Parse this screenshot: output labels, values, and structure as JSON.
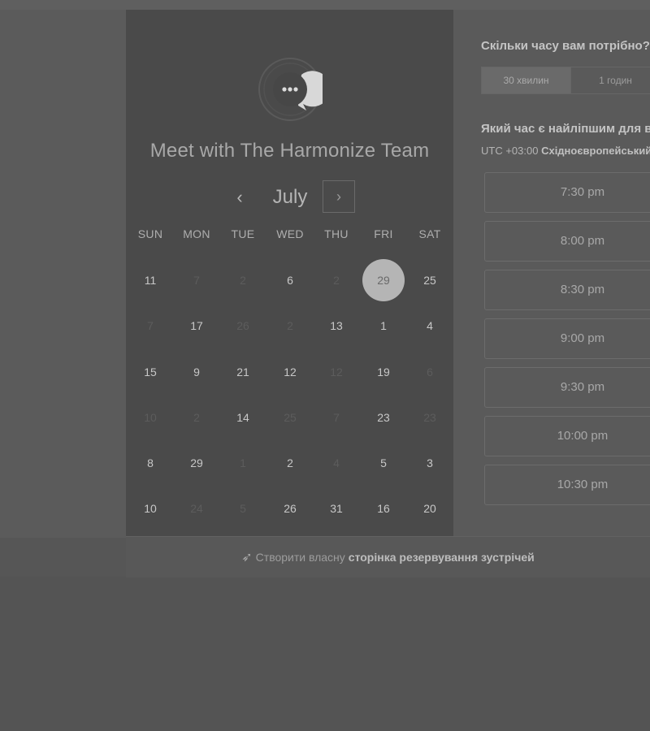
{
  "header": {
    "title": "Meet with The Harmonize Team"
  },
  "logo": {
    "icon": "chat-bubble-icon"
  },
  "calendar": {
    "month": "July",
    "prev_icon": "‹",
    "next_icon": "›",
    "weekdays": [
      "SUN",
      "MON",
      "TUE",
      "WED",
      "THU",
      "FRI",
      "SAT"
    ],
    "weeks": [
      [
        {
          "d": "11",
          "a": true
        },
        {
          "d": "7",
          "a": false
        },
        {
          "d": "2",
          "a": false
        },
        {
          "d": "6",
          "a": true
        },
        {
          "d": "2",
          "a": false
        },
        {
          "d": "29",
          "a": true,
          "sel": true
        },
        {
          "d": "25",
          "a": true
        }
      ],
      [
        {
          "d": "7",
          "a": false
        },
        {
          "d": "17",
          "a": true
        },
        {
          "d": "26",
          "a": false
        },
        {
          "d": "2",
          "a": false
        },
        {
          "d": "13",
          "a": true
        },
        {
          "d": "1",
          "a": true
        },
        {
          "d": "4",
          "a": true
        }
      ],
      [
        {
          "d": "15",
          "a": true
        },
        {
          "d": "9",
          "a": true
        },
        {
          "d": "21",
          "a": true
        },
        {
          "d": "12",
          "a": true
        },
        {
          "d": "12",
          "a": false
        },
        {
          "d": "19",
          "a": true
        },
        {
          "d": "6",
          "a": false
        }
      ],
      [
        {
          "d": "10",
          "a": false
        },
        {
          "d": "2",
          "a": false
        },
        {
          "d": "14",
          "a": true
        },
        {
          "d": "25",
          "a": false
        },
        {
          "d": "7",
          "a": false
        },
        {
          "d": "23",
          "a": true
        },
        {
          "d": "23",
          "a": false
        }
      ],
      [
        {
          "d": "8",
          "a": true
        },
        {
          "d": "29",
          "a": true
        },
        {
          "d": "1",
          "a": false
        },
        {
          "d": "2",
          "a": true
        },
        {
          "d": "4",
          "a": false
        },
        {
          "d": "5",
          "a": true
        },
        {
          "d": "3",
          "a": true
        }
      ],
      [
        {
          "d": "10",
          "a": true
        },
        {
          "d": "24",
          "a": false
        },
        {
          "d": "5",
          "a": false
        },
        {
          "d": "26",
          "a": true
        },
        {
          "d": "31",
          "a": true
        },
        {
          "d": "16",
          "a": true
        },
        {
          "d": "20",
          "a": true
        }
      ]
    ]
  },
  "booking": {
    "duration_title": "Скільки часу вам потрібно?",
    "durations": [
      {
        "label": "30 хвилин",
        "active": true
      },
      {
        "label": "1 годин",
        "active": false
      }
    ],
    "time_title": "Який час є найліпшим для вас?",
    "timezone_offset": "UTC +03:00",
    "timezone_name": "Східноєвропейський час",
    "slots": [
      "7:30 pm",
      "8:00 pm",
      "8:30 pm",
      "9:00 pm",
      "9:30 pm",
      "10:00 pm",
      "10:30 pm"
    ]
  },
  "footer": {
    "icon": "sparkle-cursor-icon",
    "lead_text": "Створити власну",
    "link_text": "сторінка резервування зустрічей"
  }
}
